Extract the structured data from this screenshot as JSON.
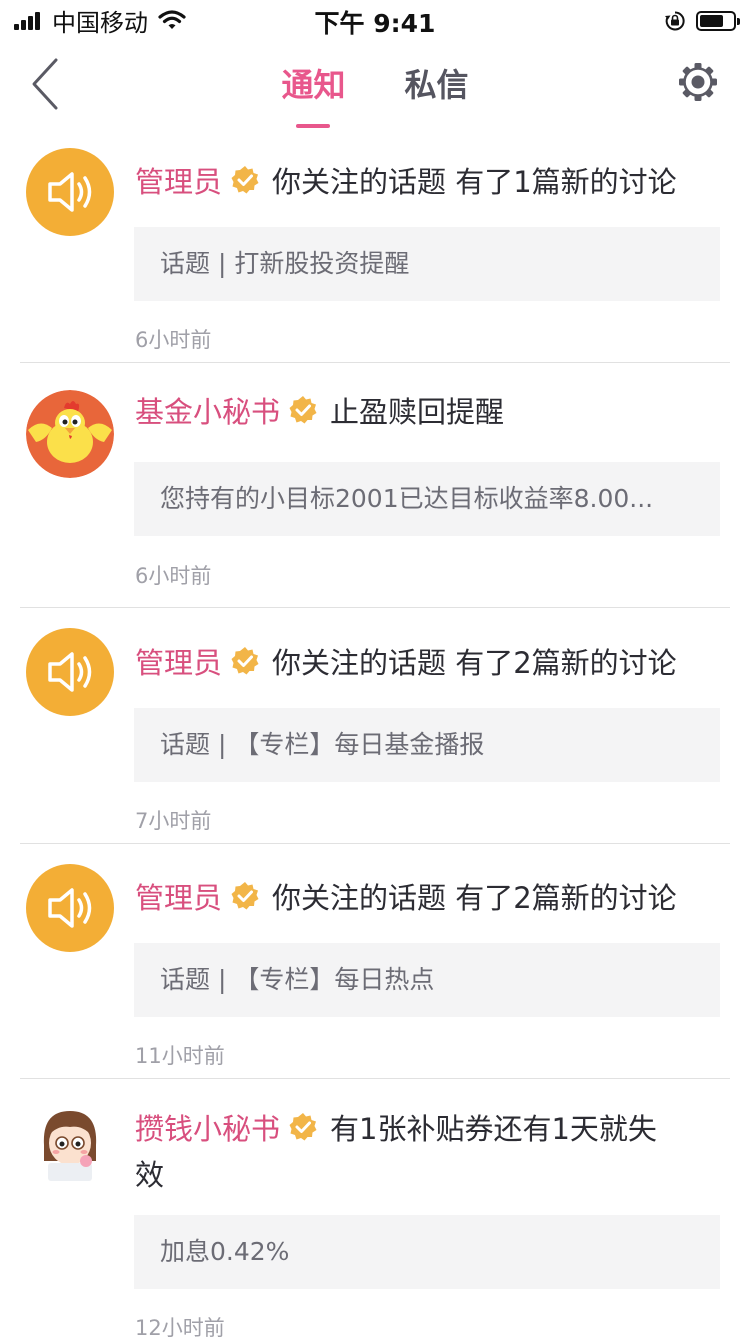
{
  "status_bar": {
    "carrier": "中国移动",
    "time": "下午 9:41"
  },
  "nav": {
    "tabs": [
      {
        "label": "通知",
        "active": true
      },
      {
        "label": "私信",
        "active": false
      }
    ]
  },
  "colors": {
    "accent": "#e8578c",
    "sender": "#d84f7e",
    "speaker_avatar": "#f3ae36",
    "verified_badge": "#f2b548",
    "quote_bg": "#f4f4f5"
  },
  "notifications": [
    {
      "avatar": "speaker-icon",
      "sender": "管理员",
      "message": "你关注的话题 有了1篇新的讨论",
      "quote": "话题 | 打新股投资提醒",
      "time": "6小时前"
    },
    {
      "avatar": "rooster-mascot",
      "sender": "基金小秘书",
      "message": "止盈赎回提醒",
      "quote": "您持有的小目标2001已达目标收益率8.00...",
      "time": "6小时前"
    },
    {
      "avatar": "speaker-icon",
      "sender": "管理员",
      "message": "你关注的话题 有了2篇新的讨论",
      "quote": "话题 | 【专栏】每日基金播报",
      "time": "7小时前"
    },
    {
      "avatar": "speaker-icon",
      "sender": "管理员",
      "message": "你关注的话题 有了2篇新的讨论",
      "quote": "话题 | 【专栏】每日热点",
      "time": "11小时前"
    },
    {
      "avatar": "girl-avatar",
      "sender": "攒钱小秘书",
      "message": "有1张补贴券还有1天就失效",
      "quote": "加息0.42%",
      "time": "12小时前"
    }
  ]
}
